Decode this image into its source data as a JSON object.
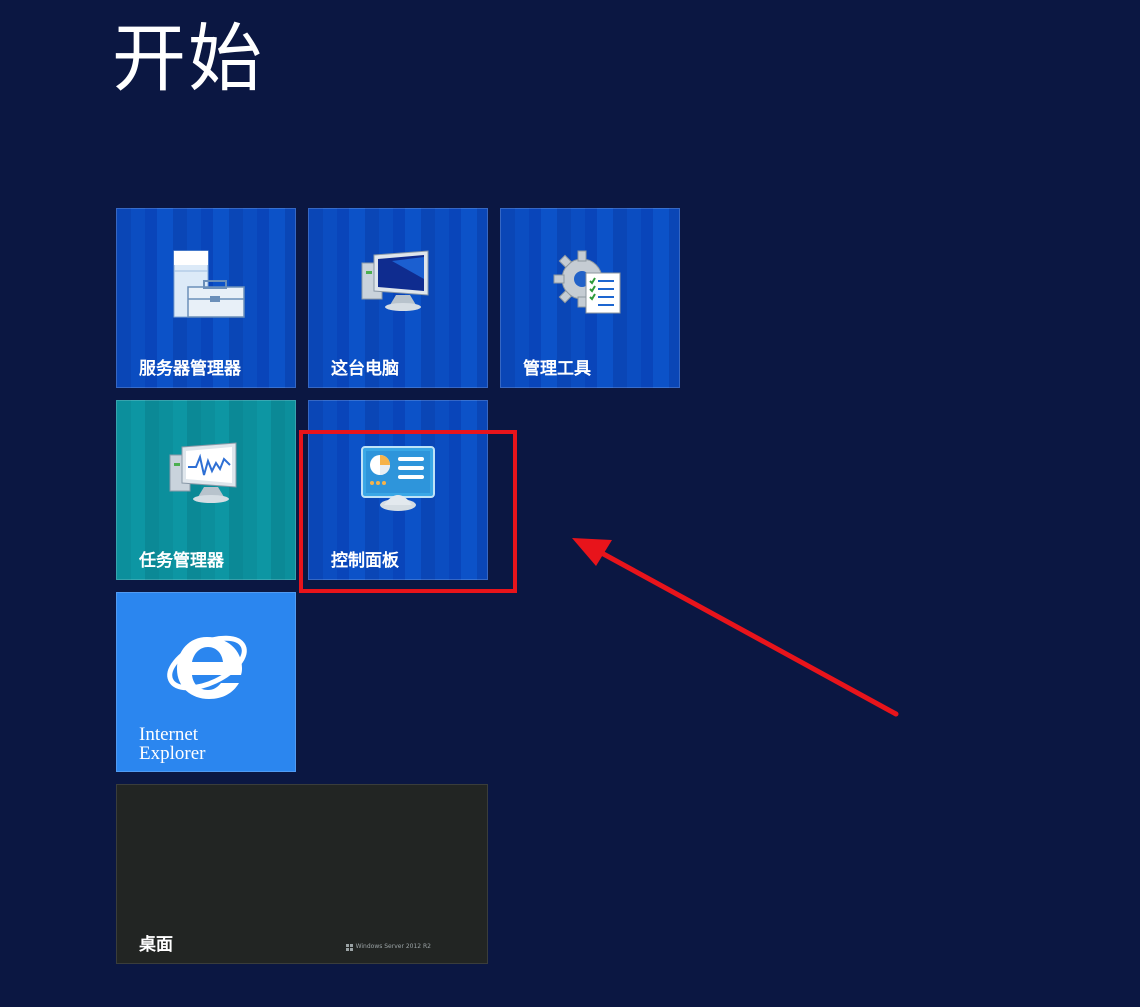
{
  "screen": {
    "title": "开始",
    "background_color": "#0b1742"
  },
  "tiles": {
    "server_manager": {
      "label": "服务器管理器",
      "icon": "server-manager-icon",
      "color": "#0a46b6"
    },
    "this_pc": {
      "label": "这台电脑",
      "icon": "computer-monitor-icon",
      "color": "#0a46b6"
    },
    "admin_tools": {
      "label": "管理工具",
      "icon": "gear-checklist-icon",
      "color": "#0a46b6"
    },
    "task_manager": {
      "label": "任务管理器",
      "icon": "performance-monitor-icon",
      "color": "#0c8f9c"
    },
    "control_panel": {
      "label": "控制面板",
      "icon": "control-panel-icon",
      "color": "#0a46b6"
    },
    "internet_explorer": {
      "label_line1": "Internet",
      "label_line2": "Explorer",
      "icon": "internet-explorer-icon",
      "color": "#2b86ef"
    },
    "desktop": {
      "label": "桌面",
      "brand_text": "Windows Server 2012 R2",
      "icon": "windows-logo-icon",
      "color": "#222523"
    }
  },
  "annotation": {
    "highlight_color": "#e8141b",
    "target": "控制面板"
  }
}
